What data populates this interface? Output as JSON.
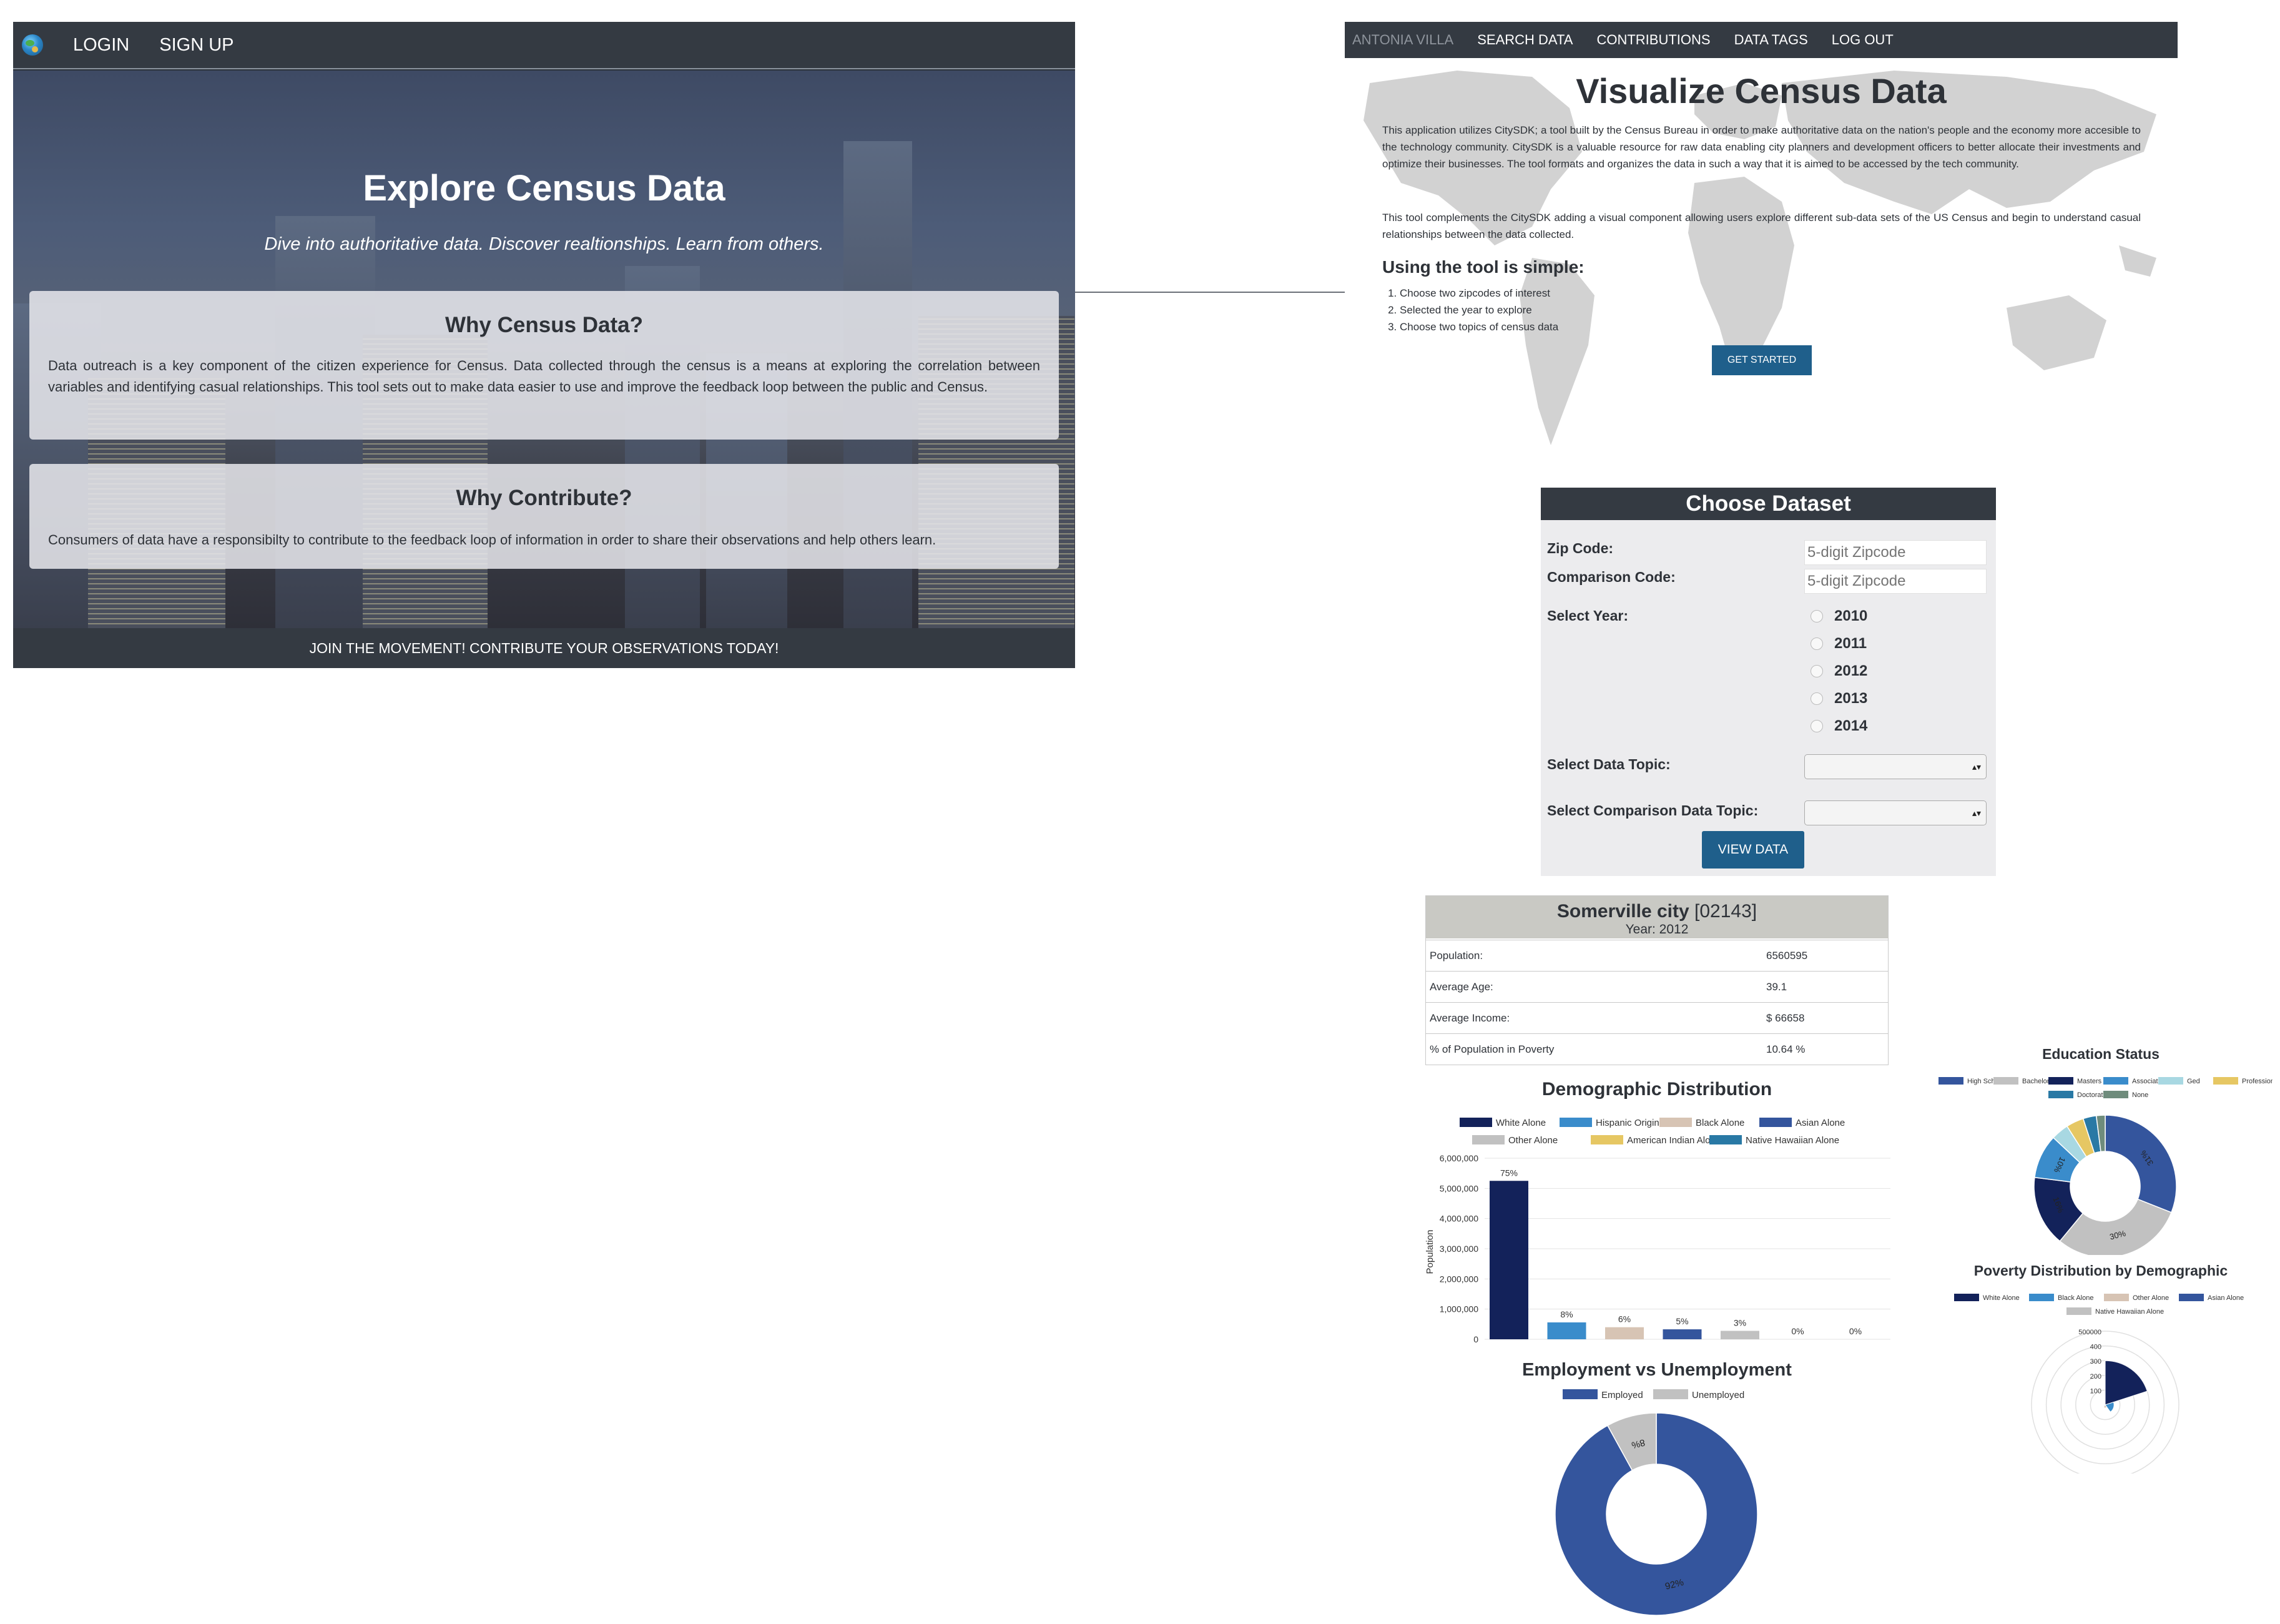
{
  "left_panel": {
    "nav": {
      "login": "LOGIN",
      "signup": "SIGN UP"
    },
    "title": "Explore Census Data",
    "subtitle": "Dive into authoritative data. Discover realtionships. Learn from others.",
    "card1": {
      "title": "Why Census Data?",
      "text": "Data outreach is a key component of the citizen experience for Census. Data collected through the census is a means at exploring the correlation between variables and identifying casual relationships. This tool sets out to make data easier to use and improve the feedback loop between the public and Census."
    },
    "card2": {
      "title": "Why Contribute?",
      "text": "Consumers of data have a responsibilty to contribute to the feedback loop of information in order to share their observations and help others learn."
    },
    "footer": "JOIN THE MOVEMENT! CONTRIBUTE YOUR OBSERVATIONS TODAY!"
  },
  "right_panel": {
    "nav": {
      "user": "ANTONIA VILLA",
      "search": "SEARCH DATA",
      "contributions": "CONTRIBUTIONS",
      "tags": "DATA TAGS",
      "logout": "LOG OUT"
    },
    "title": "Visualize Census Data",
    "para1": "This application utilizes CitySDK; a tool built by the Census Bureau in order to make authoritative data on the nation's people and the economy more accesible to the technology community. CitySDK is a valuable resource for raw data enabling city planners and development officers to better allocate their investments and optimize their businesses. The tool formats and organizes the data in such a way that it is aimed to be accessed by the tech community.",
    "para2": "This tool complements the CitySDK adding a visual component allowing users explore different sub-data sets of the US Census and begin to understand casual relationships between the data collected.",
    "howto_title": "Using the tool is simple:",
    "steps": [
      "Choose two zipcodes of interest",
      "Selected the year to explore",
      "Choose two topics of census data"
    ],
    "start_button": "GET STARTED"
  },
  "dataset_form": {
    "title": "Choose Dataset",
    "zip_label": "Zip Code:",
    "zip_placeholder": "5-digit Zipcode",
    "comp_label": "Comparison Code:",
    "comp_placeholder": "5-digit Zipcode",
    "year_label": "Select Year:",
    "years": [
      "2010",
      "2011",
      "2012",
      "2013",
      "2014"
    ],
    "topic_label": "Select Data Topic:",
    "comp_topic_label": "Select Comparison Data Topic:",
    "select_arrow": "▴▾",
    "view_button": "VIEW DATA"
  },
  "city_card": {
    "name": "Somerville city",
    "code": "[02143]",
    "year": "Year: 2012",
    "rows": [
      {
        "label": "Population:",
        "value": "6560595"
      },
      {
        "label": "Average Age:",
        "value": "39.1"
      },
      {
        "label": "Average Income:",
        "value": "$ 66658"
      },
      {
        "label": "% of Population in Poverty",
        "value": "10.64 %"
      }
    ]
  },
  "colors": {
    "navy": "#13225a",
    "blue": "#3a8ccb",
    "tan": "#d7c4b4",
    "royal": "#34559d",
    "gray": "#c1c1c1",
    "gold": "#e6c763",
    "teal": "#2979a5",
    "lightblue": "#a8d8e2",
    "green": "#6f8c7c",
    "dark": "#343a42"
  },
  "chart_data": [
    {
      "type": "bar",
      "title": "Demographic Distribution",
      "ylabel": "Population",
      "legend": [
        "White Alone",
        "Hispanic Origin",
        "Black Alone",
        "Asian Alone",
        "Other Alone",
        "American Indian Alone",
        "Native Hawaiian Alone"
      ],
      "values": [
        5250000,
        560000,
        400000,
        330000,
        280000,
        0,
        0
      ],
      "labels": [
        "75%",
        "8%",
        "6%",
        "5%",
        "3%",
        "0%",
        "0%"
      ],
      "yticks": [
        "0",
        "1,000,000",
        "2,000,000",
        "3,000,000",
        "4,000,000",
        "5,000,000",
        "6,000,000"
      ],
      "ylim": [
        0,
        6000000
      ]
    },
    {
      "type": "pie",
      "title": "Employment vs Unemployment",
      "legend": [
        "Employed",
        "Unemployed"
      ],
      "values": [
        92,
        8
      ],
      "labels": [
        "92%",
        "8%"
      ]
    },
    {
      "type": "pie",
      "title": "Education Status",
      "legend": [
        "High School",
        "Bachelors",
        "Masters",
        "Associates",
        "Ged",
        "Professional",
        "Doctorate",
        "None"
      ],
      "values": [
        31,
        30,
        16,
        10,
        4,
        4,
        3,
        2
      ],
      "labels": [
        "31%",
        "30%",
        "16%",
        "10%",
        "",
        "",
        "",
        ""
      ]
    },
    {
      "type": "polar",
      "title": "Poverty Distribution by Demographic",
      "legend": [
        "White Alone",
        "Black Alone",
        "Other Alone",
        "Asian Alone",
        "Native Hawaiian Alone"
      ],
      "values": [
        300000,
        60000,
        20000,
        8000,
        2000
      ],
      "rticks": [
        "100",
        "200",
        "300",
        "400",
        "500000"
      ]
    }
  ]
}
